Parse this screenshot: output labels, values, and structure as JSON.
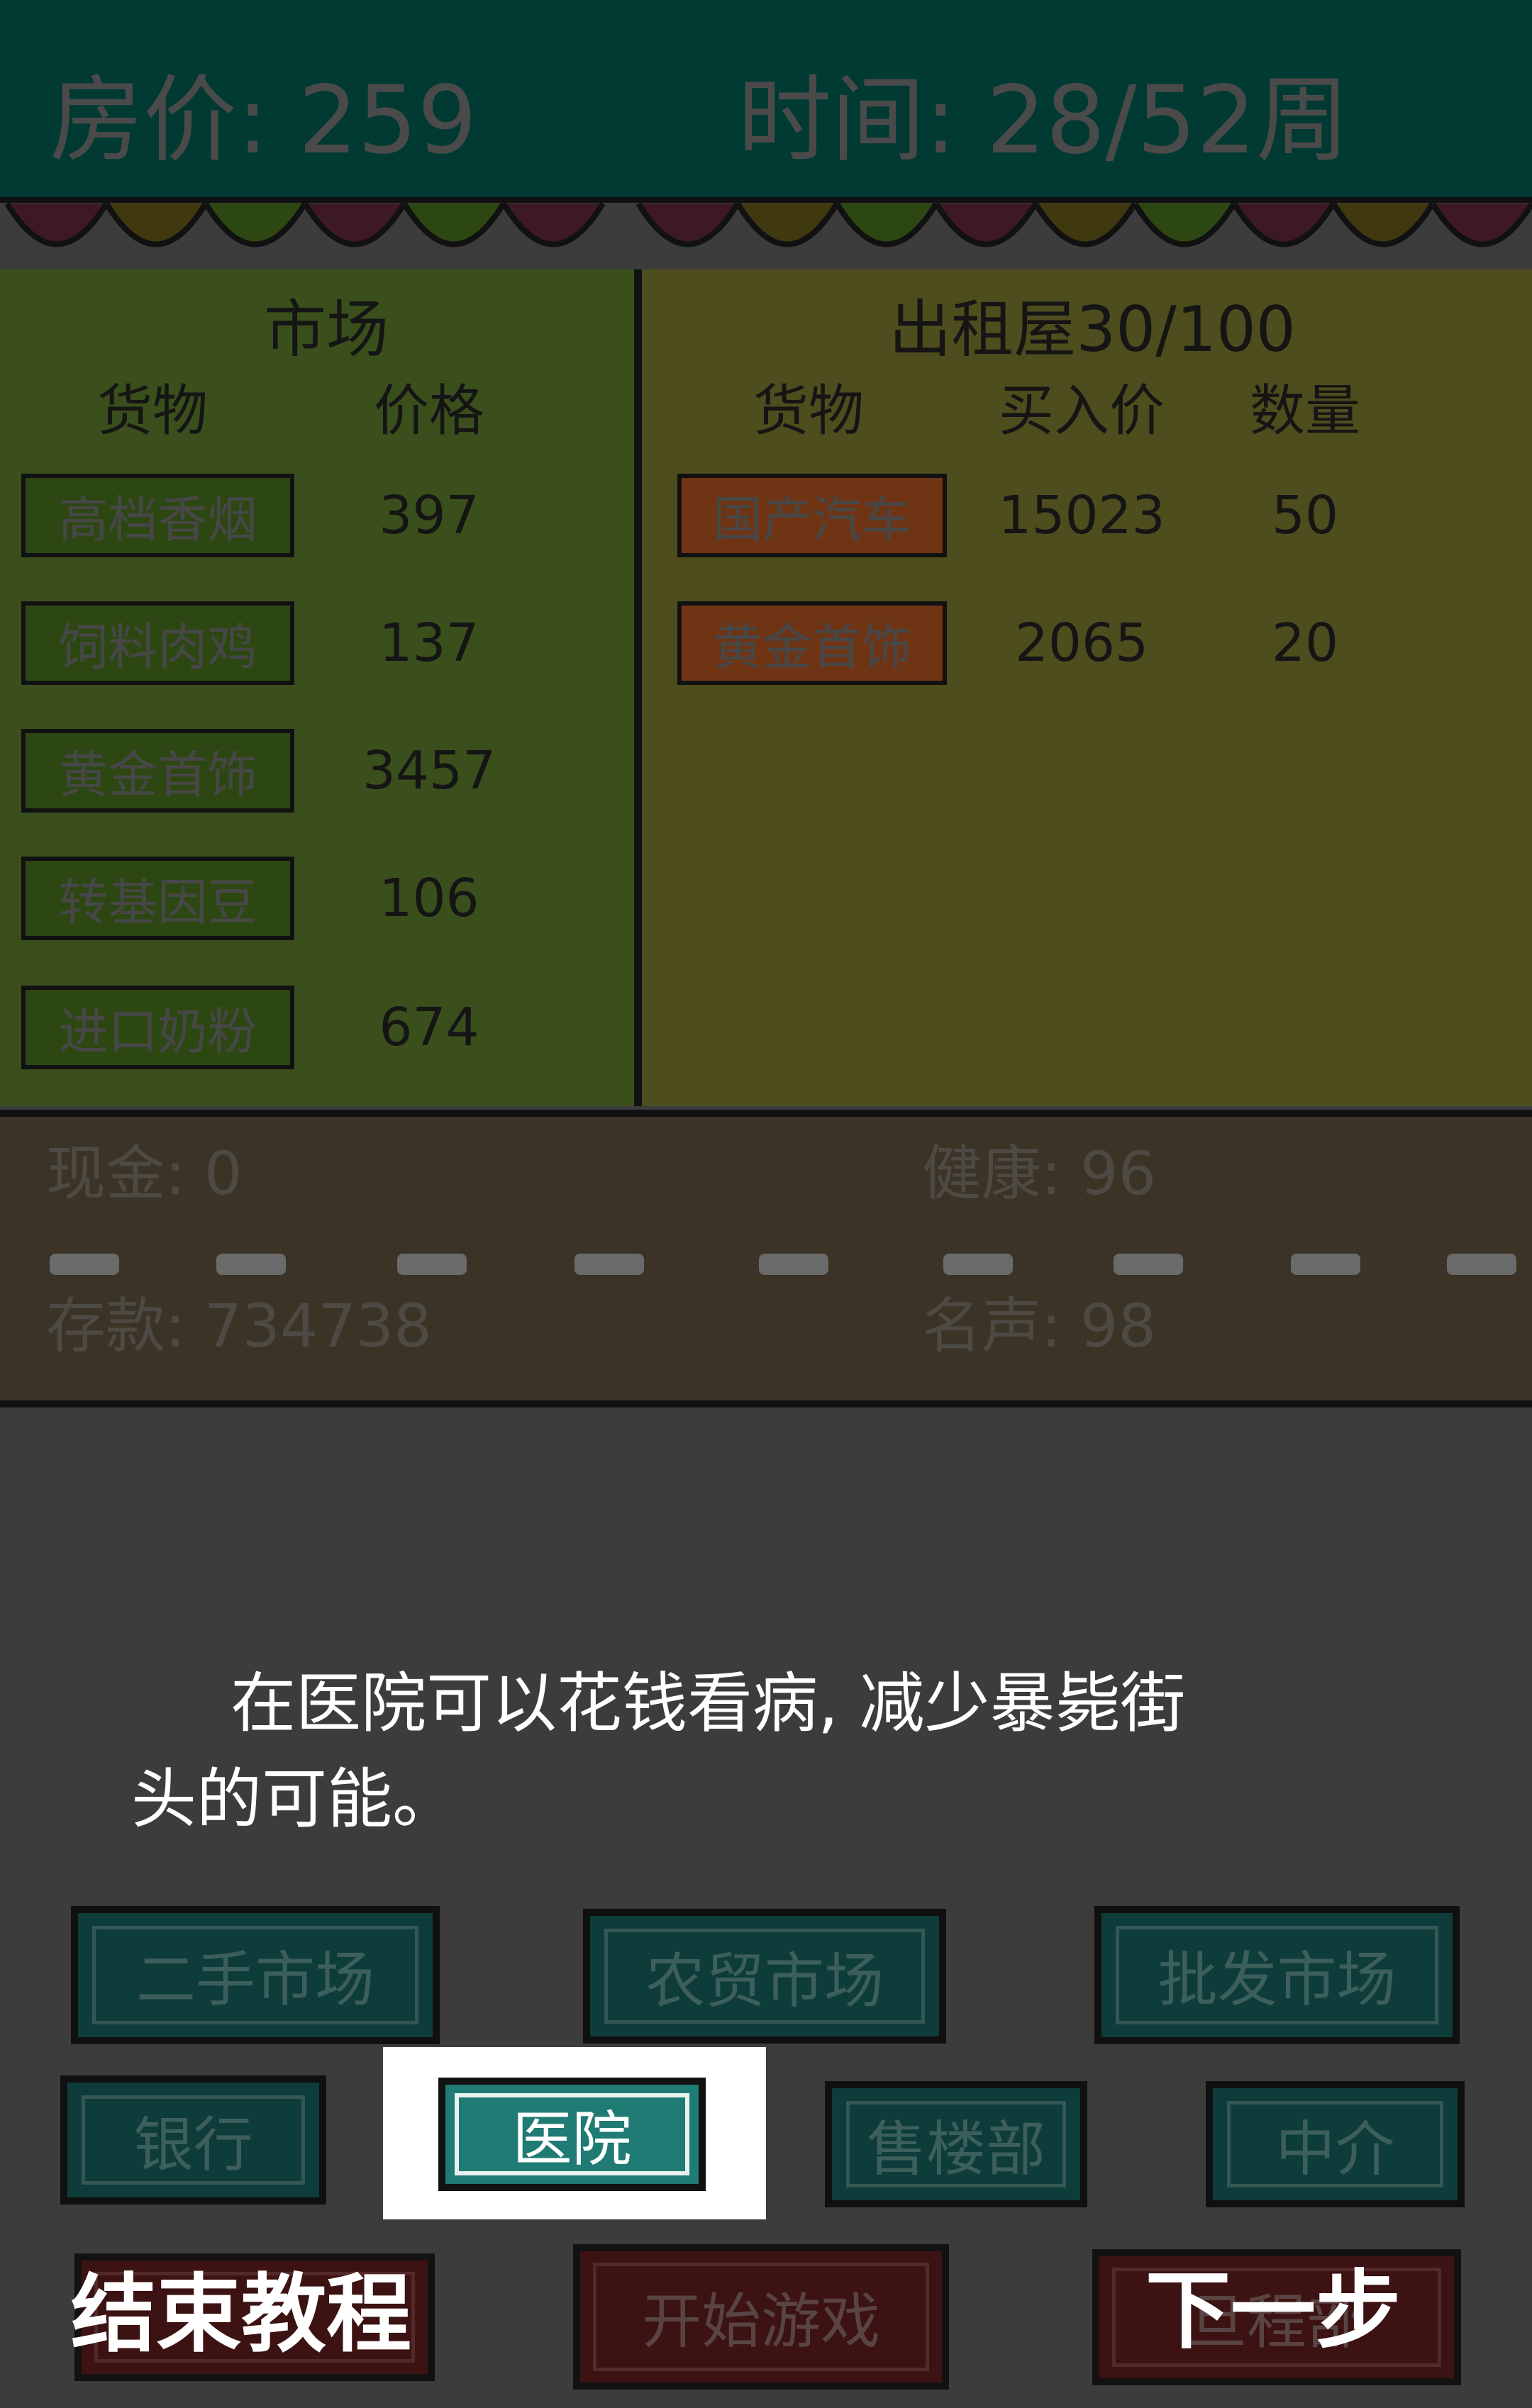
{
  "header": {
    "price_label": "房价: 259",
    "time_label": "时间: 28/52周"
  },
  "market": {
    "title": "市场",
    "col_goods": "货物",
    "col_price": "价格",
    "items": [
      {
        "name": "高档香烟",
        "price": "397"
      },
      {
        "name": "饲料肉鸡",
        "price": "137"
      },
      {
        "name": "黄金首饰",
        "price": "3457"
      },
      {
        "name": "转基因豆",
        "price": "106"
      },
      {
        "name": "进口奶粉",
        "price": "674"
      }
    ]
  },
  "rental": {
    "title": "出租屋30/100",
    "col_goods": "货物",
    "col_buy_price": "买入价",
    "col_quantity": "数量",
    "items": [
      {
        "name": "国产汽车",
        "buy_price": "15023",
        "quantity": "50"
      },
      {
        "name": "黄金首饰",
        "buy_price": "2065",
        "quantity": "20"
      }
    ]
  },
  "stats": {
    "cash": "现金: 0",
    "health": "健康: 96",
    "savings": "存款: 734738",
    "fame": "名声: 98"
  },
  "tutorial": {
    "line1": "在医院可以花钱看病, 减少暴毙街",
    "line2": "头的可能。"
  },
  "nav": {
    "second_hand_market": "二手市场",
    "farmers_market": "农贸市场",
    "wholesale_market": "批发市场",
    "bank": "银行",
    "hospital": "医院",
    "sales_office": "售楼部",
    "agency": "中介",
    "start_game": "开始游戏",
    "bottom_right_hidden": "旦程部"
  },
  "actions": {
    "end_tutorial": "结束教程",
    "next_step": "下一步"
  },
  "colors": {
    "header_bg": "#003a33",
    "nav_button_bg": "#0e3c3a",
    "hospital_button_bg": "#1f7b74",
    "overlay_bg": "#3c3c3c"
  }
}
